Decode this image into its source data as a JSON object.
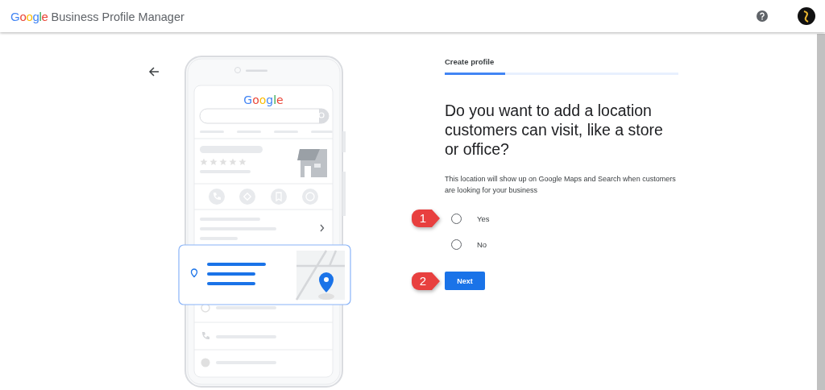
{
  "header": {
    "logo": "Google",
    "title": "Business Profile Manager"
  },
  "illustration": {
    "logo": "Google"
  },
  "stepper": {
    "label": "Create profile",
    "level": 0.26
  },
  "heading": "Do you want to add a location customers can visit, like a store or office?",
  "description": "This location will show up on Google Maps and Search when customers are looking for your business",
  "options": [
    {
      "label": "Yes",
      "selected": false,
      "callout": "1"
    },
    {
      "label": "No",
      "selected": false
    }
  ],
  "next_button": {
    "label": "Next",
    "callout": "2"
  }
}
